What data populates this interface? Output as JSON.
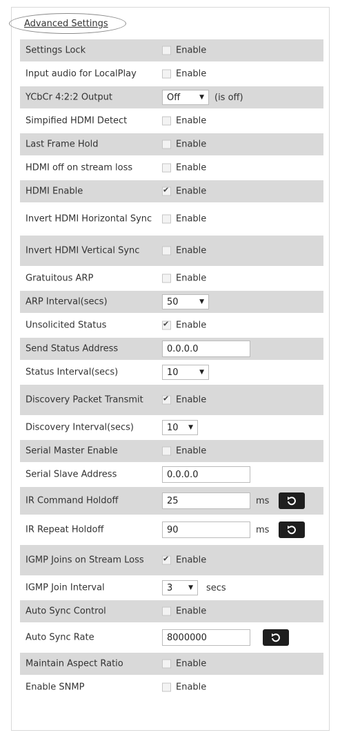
{
  "title": "Advanced Settings",
  "enable_label": "Enable",
  "rows": {
    "settings_lock": {
      "label": "Settings Lock",
      "checked": false
    },
    "input_audio": {
      "label": "Input audio for LocalPlay",
      "checked": false
    },
    "ycbcr": {
      "label": "YCbCr 4:2:2 Output",
      "value": "Off",
      "suffix": "(is off)"
    },
    "simplified_hdmi": {
      "label": "Simpified HDMI Detect",
      "checked": false
    },
    "last_frame_hold": {
      "label": "Last Frame Hold",
      "checked": false
    },
    "hdmi_off": {
      "label": "HDMI off on stream loss",
      "checked": false
    },
    "hdmi_enable": {
      "label": "HDMI Enable",
      "checked": true
    },
    "invert_h": {
      "label": "Invert HDMI Horizontal Sync",
      "checked": false
    },
    "invert_v": {
      "label": "Invert HDMI Vertical Sync",
      "checked": false
    },
    "gratuitous_arp": {
      "label": "Gratuitous ARP",
      "checked": false
    },
    "arp_interval": {
      "label": "ARP Interval(secs)",
      "value": "50"
    },
    "unsolicited": {
      "label": "Unsolicited Status",
      "checked": true
    },
    "send_status_addr": {
      "label": "Send Status Address",
      "value": "0.0.0.0"
    },
    "status_interval": {
      "label": "Status Interval(secs)",
      "value": "10"
    },
    "discovery_tx": {
      "label": "Discovery Packet Transmit",
      "checked": true
    },
    "discovery_interval": {
      "label": "Discovery Interval(secs)",
      "value": "10"
    },
    "serial_master": {
      "label": "Serial Master Enable",
      "checked": false
    },
    "serial_slave": {
      "label": "Serial Slave Address",
      "value": "0.0.0.0"
    },
    "ir_cmd_holdoff": {
      "label": "IR Command Holdoff",
      "value": "25",
      "unit": "ms"
    },
    "ir_repeat_holdoff": {
      "label": "IR Repeat Holdoff",
      "value": "90",
      "unit": "ms"
    },
    "igmp_joins": {
      "label": "IGMP Joins on Stream Loss",
      "checked": true
    },
    "igmp_interval": {
      "label": "IGMP Join Interval",
      "value": "3",
      "unit": "secs"
    },
    "auto_sync_ctrl": {
      "label": "Auto Sync Control",
      "checked": false
    },
    "auto_sync_rate": {
      "label": "Auto Sync Rate",
      "value": "8000000"
    },
    "maintain_aspect": {
      "label": "Maintain Aspect Ratio",
      "checked": false
    },
    "enable_snmp": {
      "label": "Enable SNMP",
      "checked": false
    }
  },
  "icons": {
    "reset": "reset-icon",
    "dropdown": "chevron-down-icon",
    "check": "check-icon"
  }
}
